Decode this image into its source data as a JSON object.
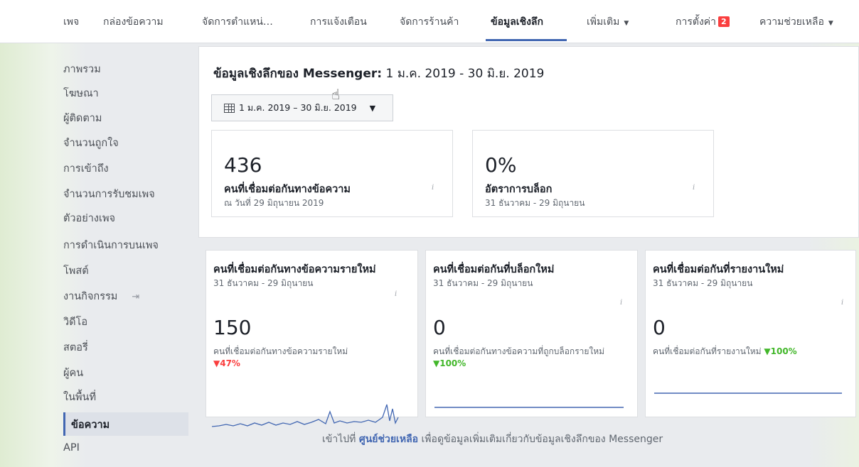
{
  "nav": {
    "items": [
      {
        "label": "เพจ"
      },
      {
        "label": "กล่องข้อความ"
      },
      {
        "label": "จัดการตำแหน่…"
      },
      {
        "label": "การแจ้งเตือน"
      },
      {
        "label": "จัดการร้านค้า"
      },
      {
        "label": "ข้อมูลเชิงลึก"
      },
      {
        "label": "เพิ่มเติม"
      },
      {
        "label": "การตั้งค่า"
      },
      {
        "label": "ความช่วยเหลือ"
      }
    ],
    "settings_badge": "2"
  },
  "sidebar": {
    "items": [
      {
        "label": "ภาพรวม"
      },
      {
        "label": "โฆษณา"
      },
      {
        "label": "ผู้ติดตาม"
      },
      {
        "label": "จำนวนถูกใจ"
      },
      {
        "label": "การเข้าถึง"
      },
      {
        "label": "จำนวนการรับชมเพจ"
      },
      {
        "label": "ตัวอย่างเพจ"
      },
      {
        "label": "การดำเนินการบนเพจ"
      },
      {
        "label": "โพสต์"
      },
      {
        "label": "งานกิจกรรม"
      },
      {
        "label": "วิดีโอ"
      },
      {
        "label": "สตอรี่"
      },
      {
        "label": "ผู้คน"
      },
      {
        "label": "ในพื้นที่"
      },
      {
        "label": "ข้อความ"
      },
      {
        "label": "API"
      }
    ],
    "active_index": 14
  },
  "overview": {
    "title_bold": "ข้อมูลเชิงลึกของ Messenger:",
    "title_range": "1 ม.ค. 2019 - 30 มิ.ย. 2019",
    "date_picker": "1 ม.ค. 2019 – 30 มิ.ย. 2019",
    "cards": [
      {
        "value": "436",
        "label": "คนที่เชื่อมต่อกันทางข้อความ",
        "sub": "ณ วันที่ 29 มิถุนายน 2019"
      },
      {
        "value": "0%",
        "label": "อัตราการบล็อก",
        "sub": "31 ธันวาคม - 29 มิถุนายน"
      }
    ]
  },
  "metrics": [
    {
      "title": "คนที่เชื่อมต่อกันทางข้อความรายใหม่",
      "sub": "31 ธันวาคม - 29 มิถุนายน",
      "value": "150",
      "desc": "คนที่เชื่อมต่อกันทางข้อความรายใหม่",
      "change": "▼47%"
    },
    {
      "title": "คนที่เชื่อมต่อกันที่บล็อกใหม่",
      "sub": "31 ธันวาคม - 29 มิถุนายน",
      "value": "0",
      "desc": "คนที่เชื่อมต่อกันทางข้อความที่ถูกบล็อกรายใหม่",
      "change": "▼100%"
    },
    {
      "title": "คนที่เชื่อมต่อกันที่รายงานใหม่",
      "sub": "31 ธันวาคม - 29 มิถุนายน",
      "value": "0",
      "desc": "คนที่เชื่อมต่อกันที่รายงานใหม่",
      "change": "▼100%"
    }
  ],
  "footer": {
    "prefix": "เข้าไปที่",
    "link": "ศูนย์ช่วยเหลือ",
    "suffix": "เพื่อดูข้อมูลเพิ่มเติมเกี่ยวกับข้อมูลเชิงลึกของ Messenger"
  },
  "icons": {
    "info": "info-icon",
    "calendar": "calendar-icon",
    "export": "export-icon",
    "cursor": "hand-cursor-icon"
  },
  "colors": {
    "accent": "#4267b2",
    "danger": "#fa3e3e",
    "success": "#42b72a",
    "line": "#4267b2"
  }
}
